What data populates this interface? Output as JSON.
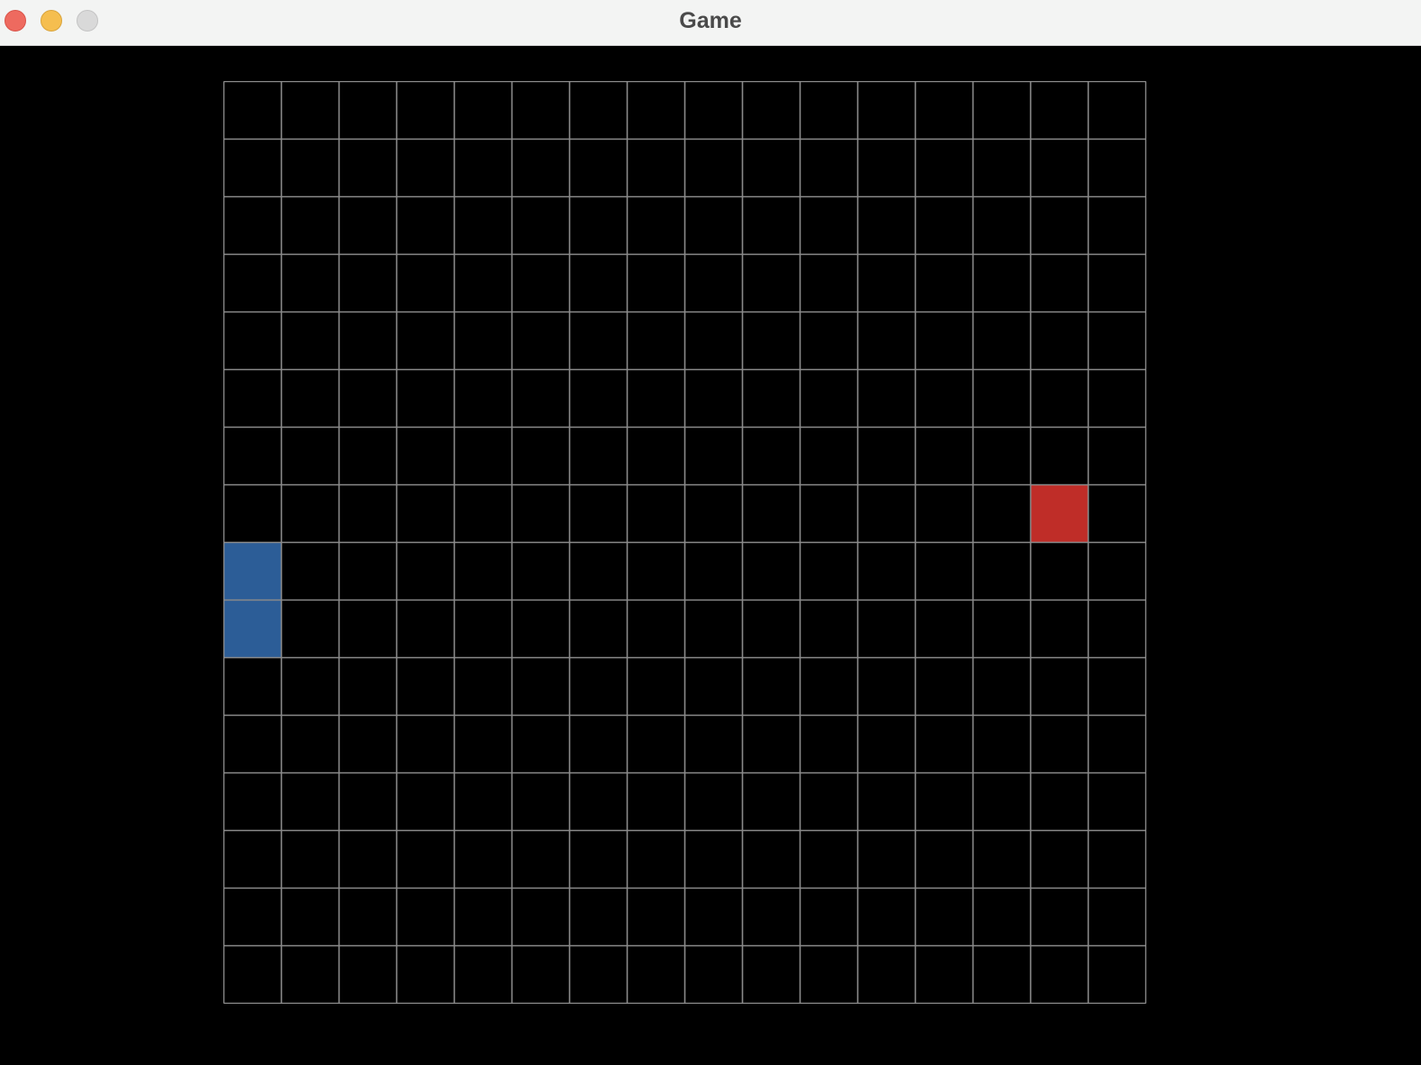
{
  "window": {
    "title": "Game",
    "controls": {
      "close_color": "#ee6a5f",
      "minimize_color": "#f5be4f",
      "zoom_color": "#d9d9d9"
    }
  },
  "game": {
    "grid": {
      "columns": 16,
      "rows": 16
    },
    "colors": {
      "background": "#000000",
      "grid_line": "#8a8a8a",
      "snake": "#2c5d97",
      "food": "#bf2d28"
    },
    "snake": [
      {
        "col": 0,
        "row": 8
      },
      {
        "col": 0,
        "row": 9
      }
    ],
    "food": {
      "col": 14,
      "row": 7
    }
  }
}
